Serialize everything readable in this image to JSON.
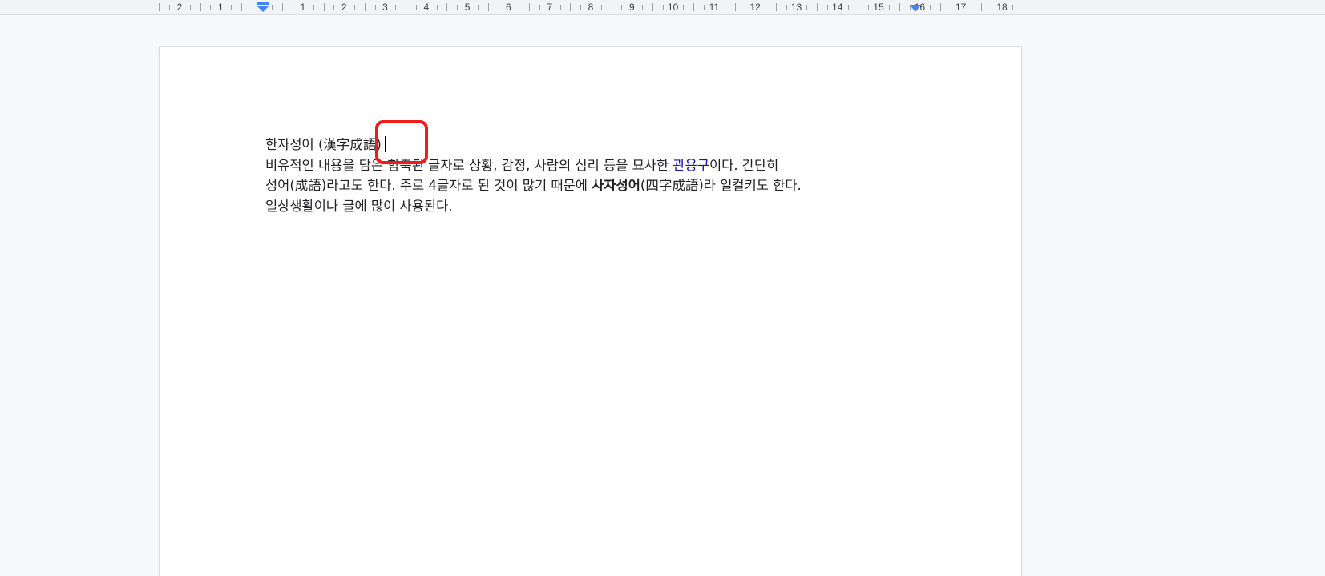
{
  "ruler": {
    "labels": [
      "2",
      "1",
      "",
      "1",
      "2",
      "3",
      "4",
      "5",
      "6",
      "7",
      "8",
      "9",
      "10",
      "11",
      "12",
      "13",
      "14",
      "15",
      "16",
      "17",
      "18"
    ],
    "left_indent_marker": "left-indent-icon",
    "right_indent_marker": "right-indent-icon"
  },
  "document": {
    "title_line": "한자성어 (漢字成語)",
    "line2_before": "비유적인 내용을 담은 함축된 글자로 상황, 감정, 사람의 심리 등을 묘사한 ",
    "line2_link": "관용구",
    "line2_after": "이다. 간단히",
    "line3_before": "성어(成語)라고도 한다. 주로 4글자로 된 것이 많기 때문에 ",
    "line3_bold": "사자성어",
    "line3_after": "(四字成語)라 일컬키도 한다.",
    "line4": "일상생활이나 글에 많이 사용된다."
  },
  "colors": {
    "link": "#1a0dab",
    "highlight": "#ee1c1c",
    "ruler_marker": "#4285f4"
  }
}
